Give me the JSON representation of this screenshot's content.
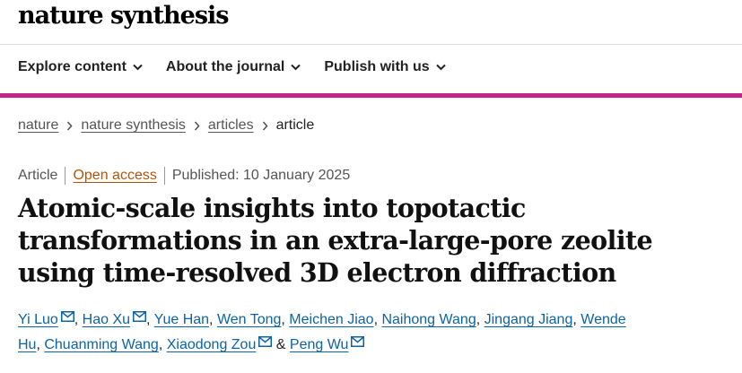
{
  "site": {
    "logo": "nature synthesis"
  },
  "nav": {
    "items": [
      {
        "label": "Explore content",
        "icon": "chevron-down-icon"
      },
      {
        "label": "About the journal",
        "icon": "chevron-down-icon"
      },
      {
        "label": "Publish with us",
        "icon": "chevron-down-icon"
      }
    ],
    "accent_color": "#c4238a"
  },
  "breadcrumb": {
    "links": [
      "nature",
      "nature synthesis",
      "articles"
    ],
    "current": "article"
  },
  "article": {
    "type": "Article",
    "access": "Open access",
    "published": "Published: 10 January 2025",
    "title": "Atomic-scale insights into topotactic transformations in an extra-large-pore zeolite using time-resolved 3D electron diffraction"
  },
  "authors": {
    "list": [
      {
        "name": "Yi Luo",
        "has_email": true
      },
      {
        "name": "Hao Xu",
        "has_email": true
      },
      {
        "name": "Yue Han",
        "has_email": false
      },
      {
        "name": "Wen Tong",
        "has_email": false
      },
      {
        "name": "Meichen Jiao",
        "has_email": false
      },
      {
        "name": "Naihong Wang",
        "has_email": false
      },
      {
        "name": "Jingang Jiang",
        "has_email": false
      },
      {
        "name": "Wende Hu",
        "has_email": false
      },
      {
        "name": "Chuanming Wang",
        "has_email": false
      },
      {
        "name": "Xiaodong Zou",
        "has_email": true
      },
      {
        "name": "Peng Wu",
        "has_email": true
      }
    ],
    "separator": ", ",
    "last_separator": " & ",
    "link_color": "#0b64a8"
  }
}
